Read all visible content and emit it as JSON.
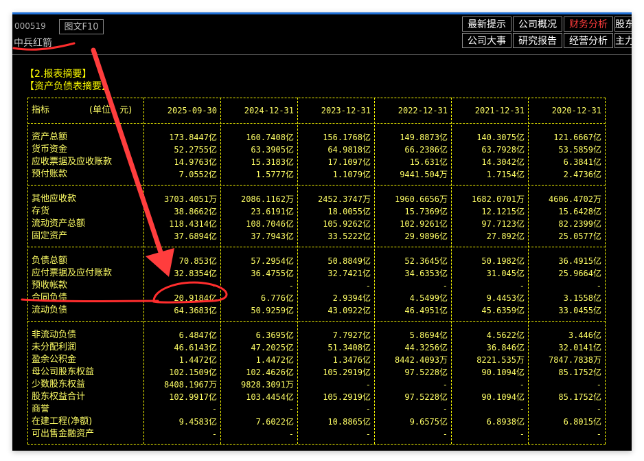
{
  "stock": {
    "code": "000519",
    "name": "中兵红箭",
    "f10_label": "图文F10"
  },
  "nav": {
    "row1": [
      "最新提示",
      "公司概况",
      "财务分析",
      "股东"
    ],
    "row2": [
      "公司大事",
      "研究报告",
      "经营分析",
      "主力"
    ],
    "active": "财务分析"
  },
  "section": {
    "title": "【2.报表摘要】",
    "subtitle": "【资产负债表摘要】"
  },
  "table": {
    "header": {
      "label": "指标",
      "unit": "(单位：元)",
      "dates": [
        "2025-09-30",
        "2024-12-31",
        "2023-12-31",
        "2022-12-31",
        "2021-12-31",
        "2020-12-31"
      ]
    },
    "rows": [
      {
        "label": "资产总额",
        "values": [
          "173.8447亿",
          "160.7408亿",
          "156.1768亿",
          "149.8873亿",
          "140.3075亿",
          "121.6667亿"
        ]
      },
      {
        "label": "货币资金",
        "values": [
          "52.2755亿",
          "63.3905亿",
          "64.9818亿",
          "66.2386亿",
          "63.7928亿",
          "53.5859亿"
        ]
      },
      {
        "label": "应收票据及应收账款",
        "values": [
          "14.9763亿",
          "15.3183亿",
          "17.1097亿",
          "15.631亿",
          "14.3042亿",
          "6.3841亿"
        ]
      },
      {
        "label": "预付账款",
        "values": [
          "7.0552亿",
          "1.5777亿",
          "1.1079亿",
          "9441.504万",
          "1.7154亿",
          "2.4736亿"
        ]
      },
      {
        "label": "其他应收款",
        "values": [
          "3703.4051万",
          "2086.1162万",
          "2452.3747万",
          "1960.6656万",
          "1682.0701万",
          "4606.4702万"
        ]
      },
      {
        "label": "存货",
        "values": [
          "38.8662亿",
          "23.6191亿",
          "18.0055亿",
          "15.7369亿",
          "12.1215亿",
          "15.6428亿"
        ]
      },
      {
        "label": "流动资产总额",
        "values": [
          "118.4314亿",
          "108.7046亿",
          "105.9262亿",
          "102.9261亿",
          "97.7123亿",
          "82.2399亿"
        ]
      },
      {
        "label": "固定资产",
        "values": [
          "37.6894亿",
          "37.7943亿",
          "33.5222亿",
          "29.9896亿",
          "27.892亿",
          "25.0577亿"
        ]
      },
      {
        "label": "负债总额",
        "values": [
          "70.853亿",
          "57.2954亿",
          "50.8849亿",
          "52.3645亿",
          "50.1982亿",
          "36.4915亿"
        ]
      },
      {
        "label": "应付票据及应付账款",
        "values": [
          "32.8354亿",
          "36.4755亿",
          "32.7421亿",
          "34.6353亿",
          "31.045亿",
          "25.9664亿"
        ]
      },
      {
        "label": "预收帐款",
        "values": [
          "-",
          "-",
          "-",
          "-",
          "-",
          "-"
        ]
      },
      {
        "label": "合同负债",
        "values": [
          "20.9184亿",
          "6.776亿",
          "2.9394亿",
          "4.5499亿",
          "9.4453亿",
          "3.1558亿"
        ]
      },
      {
        "label": "流动负债",
        "values": [
          "64.3683亿",
          "50.9259亿",
          "43.0922亿",
          "46.4951亿",
          "45.6359亿",
          "33.0455亿"
        ]
      },
      {
        "label": "非流动负债",
        "values": [
          "6.4847亿",
          "6.3695亿",
          "7.7927亿",
          "5.8694亿",
          "4.5622亿",
          "3.446亿"
        ]
      },
      {
        "label": "未分配利润",
        "values": [
          "46.6143亿",
          "47.2025亿",
          "51.3408亿",
          "44.3256亿",
          "36.846亿",
          "32.0141亿"
        ]
      },
      {
        "label": "盈余公积金",
        "values": [
          "1.4472亿",
          "1.4472亿",
          "1.3476亿",
          "8442.4093万",
          "8221.535万",
          "7847.7838万"
        ]
      },
      {
        "label": "母公司股东权益",
        "values": [
          "102.1509亿",
          "102.4626亿",
          "105.2919亿",
          "97.5228亿",
          "90.1094亿",
          "85.1752亿"
        ]
      },
      {
        "label": "少数股东权益",
        "values": [
          "8408.1967万",
          "9828.3091万",
          "-",
          "-",
          "-",
          "-"
        ]
      },
      {
        "label": "股东权益合计",
        "values": [
          "102.9917亿",
          "103.4454亿",
          "105.2919亿",
          "97.5228亿",
          "90.1094亿",
          "85.1752亿"
        ]
      },
      {
        "label": "商誉",
        "values": [
          "-",
          "-",
          "-",
          "-",
          "-",
          "-"
        ]
      },
      {
        "label": "在建工程(净额)",
        "values": [
          "9.4583亿",
          "7.6022亿",
          "10.8865亿",
          "9.6575亿",
          "6.8938亿",
          "6.8015亿"
        ]
      },
      {
        "label": "可出售金融资产",
        "values": [
          "-",
          "-",
          "-",
          "-",
          "-",
          "-"
        ]
      }
    ]
  },
  "colors": {
    "background": "#000000",
    "table_text": "#ffff66",
    "annotation": "#ff2d2d",
    "active_tab": "#ff3b3b"
  }
}
